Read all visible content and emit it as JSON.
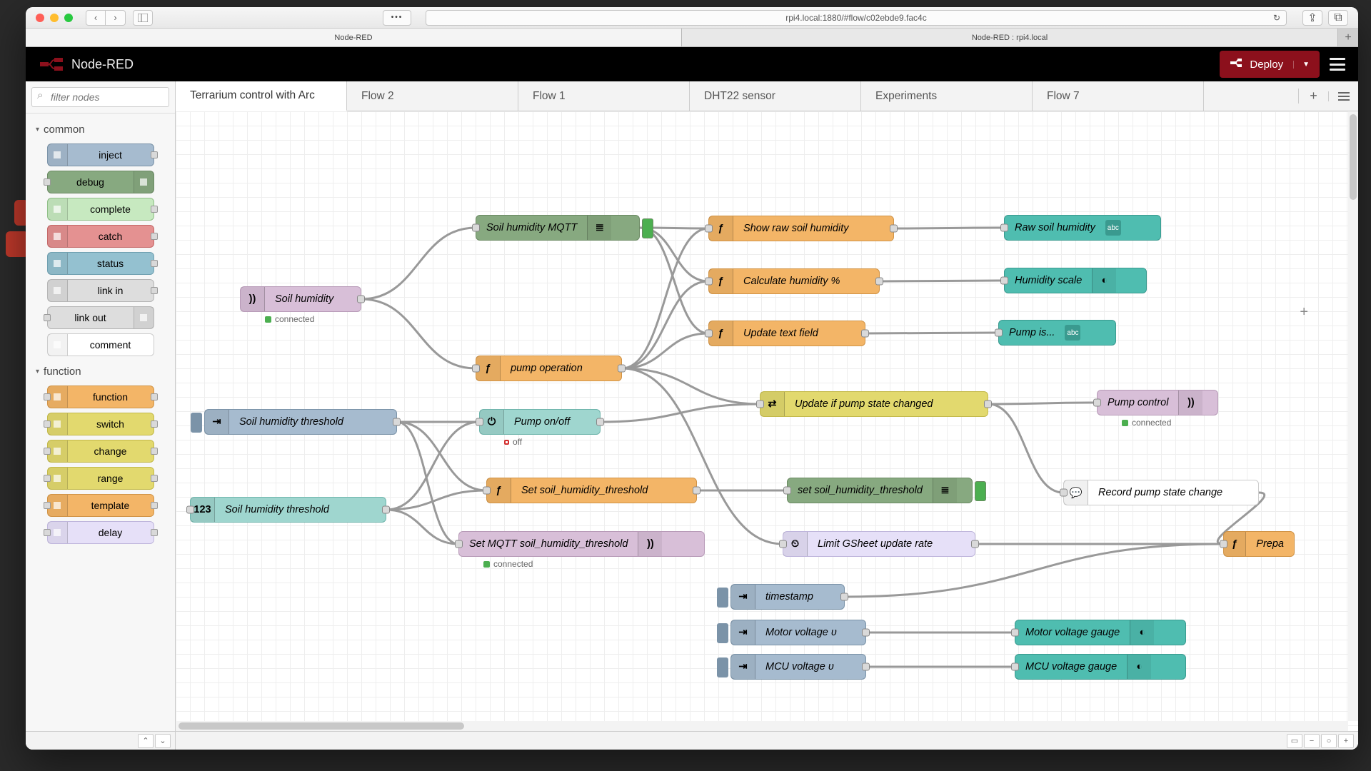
{
  "browser": {
    "url": "rpi4.local:1880/#flow/c02ebde9.fac4c",
    "tabs": [
      "Node-RED",
      "Node-RED : rpi4.local"
    ],
    "active_tab": 0
  },
  "header": {
    "title": "Node-RED",
    "deploy_label": "Deploy"
  },
  "palette": {
    "filter_placeholder": "filter nodes",
    "categories": [
      {
        "name": "common",
        "nodes": [
          {
            "label": "inject",
            "bg": "#a6bbcf",
            "border": "#7b93a8",
            "icon_side": "left",
            "ports": [
              "right"
            ]
          },
          {
            "label": "debug",
            "bg": "#87a980",
            "border": "#6b8a63",
            "icon_side": "right",
            "ports": [
              "left"
            ]
          },
          {
            "label": "complete",
            "bg": "#c7e9c0",
            "border": "#8fbf87",
            "icon_side": "left",
            "ports": [
              "right"
            ]
          },
          {
            "label": "catch",
            "bg": "#e49191",
            "border": "#c46767",
            "icon_side": "left",
            "ports": [
              "right"
            ]
          },
          {
            "label": "status",
            "bg": "#94c1d0",
            "border": "#6fa0b0",
            "icon_side": "left",
            "ports": [
              "right"
            ]
          },
          {
            "label": "link in",
            "bg": "#dddddd",
            "border": "#b5b5b5",
            "icon_side": "left",
            "ports": [
              "right"
            ]
          },
          {
            "label": "link out",
            "bg": "#dddddd",
            "border": "#b5b5b5",
            "icon_side": "right",
            "ports": [
              "left"
            ]
          },
          {
            "label": "comment",
            "bg": "#ffffff",
            "border": "#cccccc",
            "icon_side": "left",
            "ports": []
          }
        ]
      },
      {
        "name": "function",
        "nodes": [
          {
            "label": "function",
            "bg": "#f3b567",
            "border": "#d19447",
            "icon_side": "left",
            "ports": [
              "left",
              "right"
            ]
          },
          {
            "label": "switch",
            "bg": "#e2d96e",
            "border": "#c3b94a",
            "icon_side": "left",
            "ports": [
              "left",
              "right"
            ]
          },
          {
            "label": "change",
            "bg": "#e2d96e",
            "border": "#c3b94a",
            "icon_side": "left",
            "ports": [
              "left",
              "right"
            ]
          },
          {
            "label": "range",
            "bg": "#e2d96e",
            "border": "#c3b94a",
            "icon_side": "left",
            "ports": [
              "left",
              "right"
            ]
          },
          {
            "label": "template",
            "bg": "#f3b567",
            "border": "#d19447",
            "icon_side": "left",
            "ports": [
              "left",
              "right"
            ]
          },
          {
            "label": "delay",
            "bg": "#e6e0f8",
            "border": "#bfb6dc",
            "icon_side": "left",
            "ports": [
              "left",
              "right"
            ]
          }
        ]
      }
    ]
  },
  "flow_tabs": {
    "tabs": [
      "Terrarium control with Arc",
      "Flow 2",
      "Flow 1",
      "DHT22 sensor",
      "Experiments",
      "Flow 7"
    ],
    "active": 0
  },
  "nodes": {
    "soil_humidity": {
      "label": "Soil humidity",
      "status": "connected"
    },
    "soil_mqtt": {
      "label": "Soil humidity MQTT"
    },
    "show_raw": {
      "label": "Show raw soil humidity"
    },
    "raw_hum": {
      "label": "Raw soil humidity",
      "badge": "abc"
    },
    "calc_hum": {
      "label": "Calculate humidity %"
    },
    "hum_scale": {
      "label": "Humidity scale"
    },
    "update_text": {
      "label": "Update text field"
    },
    "pump_is": {
      "label": "Pump is...",
      "badge": "abc"
    },
    "pump_op": {
      "label": "pump operation"
    },
    "update_pump_state": {
      "label": "Update if pump state changed"
    },
    "pump_control": {
      "label": "Pump control",
      "status": "connected"
    },
    "pump_onoff": {
      "label": "Pump on/off",
      "status": "off"
    },
    "record_pump": {
      "label": "Record pump state change"
    },
    "sh_thresh_inject": {
      "label": "Soil humidity threshold"
    },
    "sh_thresh_num": {
      "label": "Soil humidity threshold"
    },
    "set_sh_thresh": {
      "label": "Set soil_humidity_threshold"
    },
    "set_mqtt_thresh": {
      "label": "Set MQTT soil_humidity_threshold",
      "status": "connected"
    },
    "set_sh_debug": {
      "label": "set soil_humidity_threshold"
    },
    "limit_gsheet": {
      "label": "Limit GSheet update rate"
    },
    "prepa": {
      "label": "Prepa"
    },
    "timestamp": {
      "label": "timestamp"
    },
    "motor_v": {
      "label": "Motor voltage ʋ"
    },
    "mcu_v": {
      "label": "MCU voltage ʋ"
    },
    "motor_gauge": {
      "label": "Motor voltage gauge"
    },
    "mcu_gauge": {
      "label": "MCU voltage gauge"
    }
  },
  "colors": {
    "mqtt_in": "#d8bfd8",
    "mqtt_border": "#b89bb8",
    "debug": "#87a980",
    "debug_border": "#6b8a63",
    "function": "#f3b567",
    "function_border": "#d19447",
    "ui_text": "#4fbdb0",
    "ui_border": "#3a9a8f",
    "switch": "#e2d96e",
    "switch_border": "#c3b94a",
    "ui_switch": "#9fd6cf",
    "ui_switch_border": "#6fb5ac",
    "inject": "#a6bbcf",
    "inject_border": "#7b93a8",
    "numeric": "#9fd6cf",
    "delay": "#e6e0f8",
    "delay_border": "#bfb6dc",
    "comment": "#ffffff",
    "comment_border": "#cccccc"
  }
}
